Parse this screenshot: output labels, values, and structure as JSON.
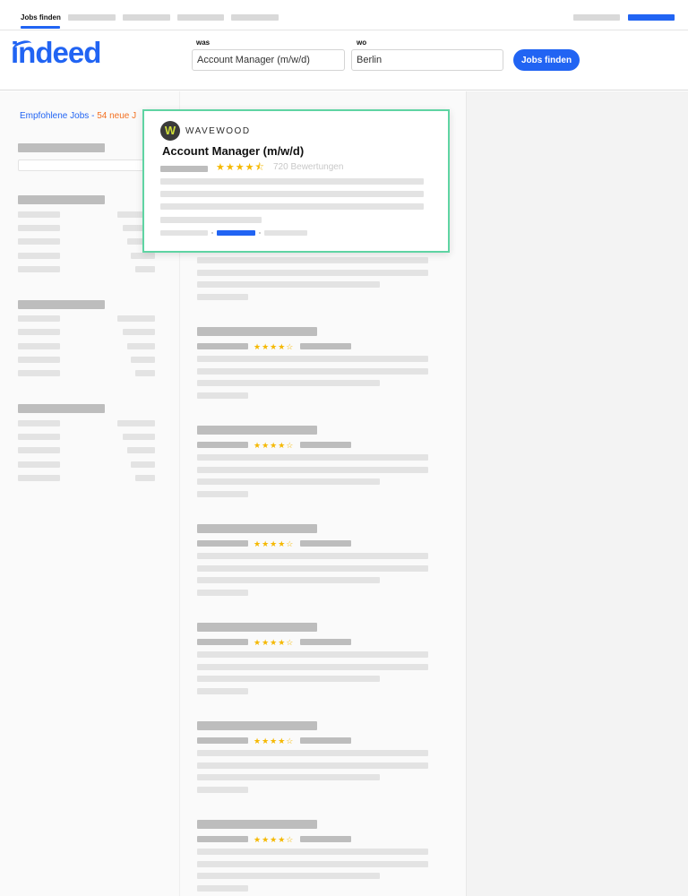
{
  "nav": {
    "active_tab": "Jobs finden"
  },
  "header": {
    "logo": "indeed",
    "what_label": "was",
    "what_value": "Account Manager (m/w/d)",
    "where_label": "wo",
    "where_value": "Berlin",
    "search_button": "Jobs finden"
  },
  "results": {
    "recommended_label": "Empfohlene Jobs",
    "separator": "-",
    "new_jobs_label": "54 neue J"
  },
  "featured_job": {
    "company": "WAVEWOOD",
    "logo_letter": "W",
    "title": "Account Manager (m/w/d)",
    "stars": "★★★★⯪",
    "rating": 4.5,
    "reviews": "720 Bewertungen"
  },
  "job_card_stars": "★★★★☆",
  "colors": {
    "accent": "#2164f3",
    "highlight": "#f37021",
    "featured_border": "#5fd4a3",
    "star": "#f5b800"
  }
}
